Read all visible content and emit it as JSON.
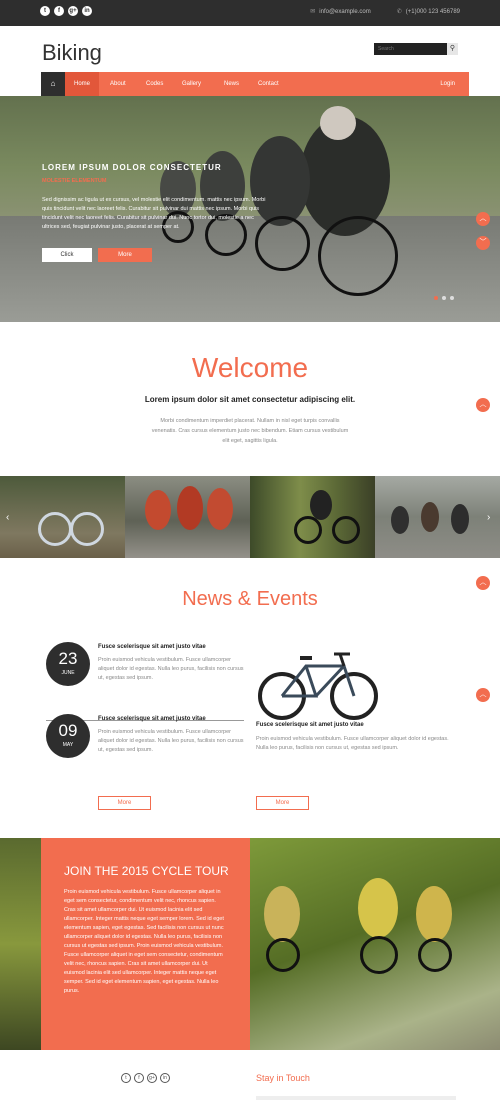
{
  "topbar": {
    "social": [
      "t",
      "f",
      "g+",
      "in"
    ],
    "email": "info@example.com",
    "phone": "(+1)000 123 456789"
  },
  "header": {
    "logo": "Biking",
    "search_placeholder": "Search",
    "search_icon": "search-icon"
  },
  "nav": {
    "home_icon": "home-icon",
    "items": [
      "Home",
      "About",
      "Codes",
      "Gallery",
      "News",
      "Contact"
    ],
    "login": "Login"
  },
  "hero": {
    "title": "LOREM IPSUM DOLOR CONSECTETUR",
    "subtitle": "MOLESTIE ELEMENTUM",
    "paragraph": "Sed dignissim ac ligula ut ex cursus, vel molestie elit condimentum. mattis nec ipsum. Morbi quis tincidunt velit nec laoreet felis. Curabitur sit pulvinar dui mattis nec ipsum. Morbi quis tincidunt velit nec laoreet felis. Curabitur sit pulvinar dui. Nunc tortor dui, molestie a nec ultrices sed, feugiat pulvinar justo, placerat at semper at.",
    "button_click": "Click",
    "button_more": "More",
    "slides_total": 3,
    "slide_active": 1
  },
  "welcome": {
    "heading": "Welcome",
    "subheading": "Lorem ipsum dolor sit amet consectetur adipiscing elit.",
    "paragraph": "Morbi condimentum imperdiet placerat. Nullam in nisl eget turpis convallis venenatis. Cras cursus elementum justo nec bibendum. Etiam cursus vestibulum elit eget, sagittis ligula."
  },
  "news": {
    "heading": "News & Events",
    "events": [
      {
        "day": "23",
        "month": "JUNE",
        "title": "Fusce scelerisque sit amet justo vitae",
        "text": "Proin euismod vehicula vestibulum. Fusce ullamcorper aliquet dolor id egestas. Nulla leo purus, facilisis non cursus ut, egestas sed ipsum."
      },
      {
        "day": "09",
        "month": "MAY",
        "title": "Fusce scelerisque sit amet justo vitae",
        "text": "Proin euismod vehicula vestibulum. Fusce ullamcorper aliquet dolor id egestas. Nulla leo purus, facilisis non cursus ut, egestas sed ipsum."
      }
    ],
    "right_title": "Fusce scelerisque sit amet justo vitae",
    "right_text": "Proin euismod vehicula vestibulum. Fusce ullamcorper aliquet dolor id egestas. Nulla leo purus, facilisis non cursus ut, egestas sed ipsum.",
    "more_label": "More"
  },
  "join": {
    "heading": "JOIN THE 2015 CYCLE TOUR",
    "paragraph": "Proin euismod vehicula vestibulum. Fusce ullamcorper aliquet in eget sem consectetur, condimentum velit nec, rhoncus sapien. Cras sit amet ullamcorper dui. Ut euismod lacinia elit sed ullamcorper. Integer mattis neque eget semper lorem. Sed id eget elementum sapien, eget egestas. Sed facilisis non cursus ut nunc ullamcorper aliquet dolor id egestas. Nulla leo purus, facilisis non cursus ut egestas sed ipsum. Proin euismod vehicula vestibulum. Fusce ullamcorper aliquet in eget sem consectetur, condimentum velit nec, rhoncus sapien. Cras sit amet ullamcorper dui. Ut euismod lacinia elit sed ullamcorper. Integer mattis neque eget semper. Sed id eget elementum sapien, eget egestas. Nulla leo purus."
  },
  "footer": {
    "social": [
      "t",
      "f",
      "g+",
      "in"
    ],
    "stay_in_touch": "Stay in Touch"
  },
  "colors": {
    "accent": "#f26d4f",
    "dark": "#2e2e2e"
  }
}
